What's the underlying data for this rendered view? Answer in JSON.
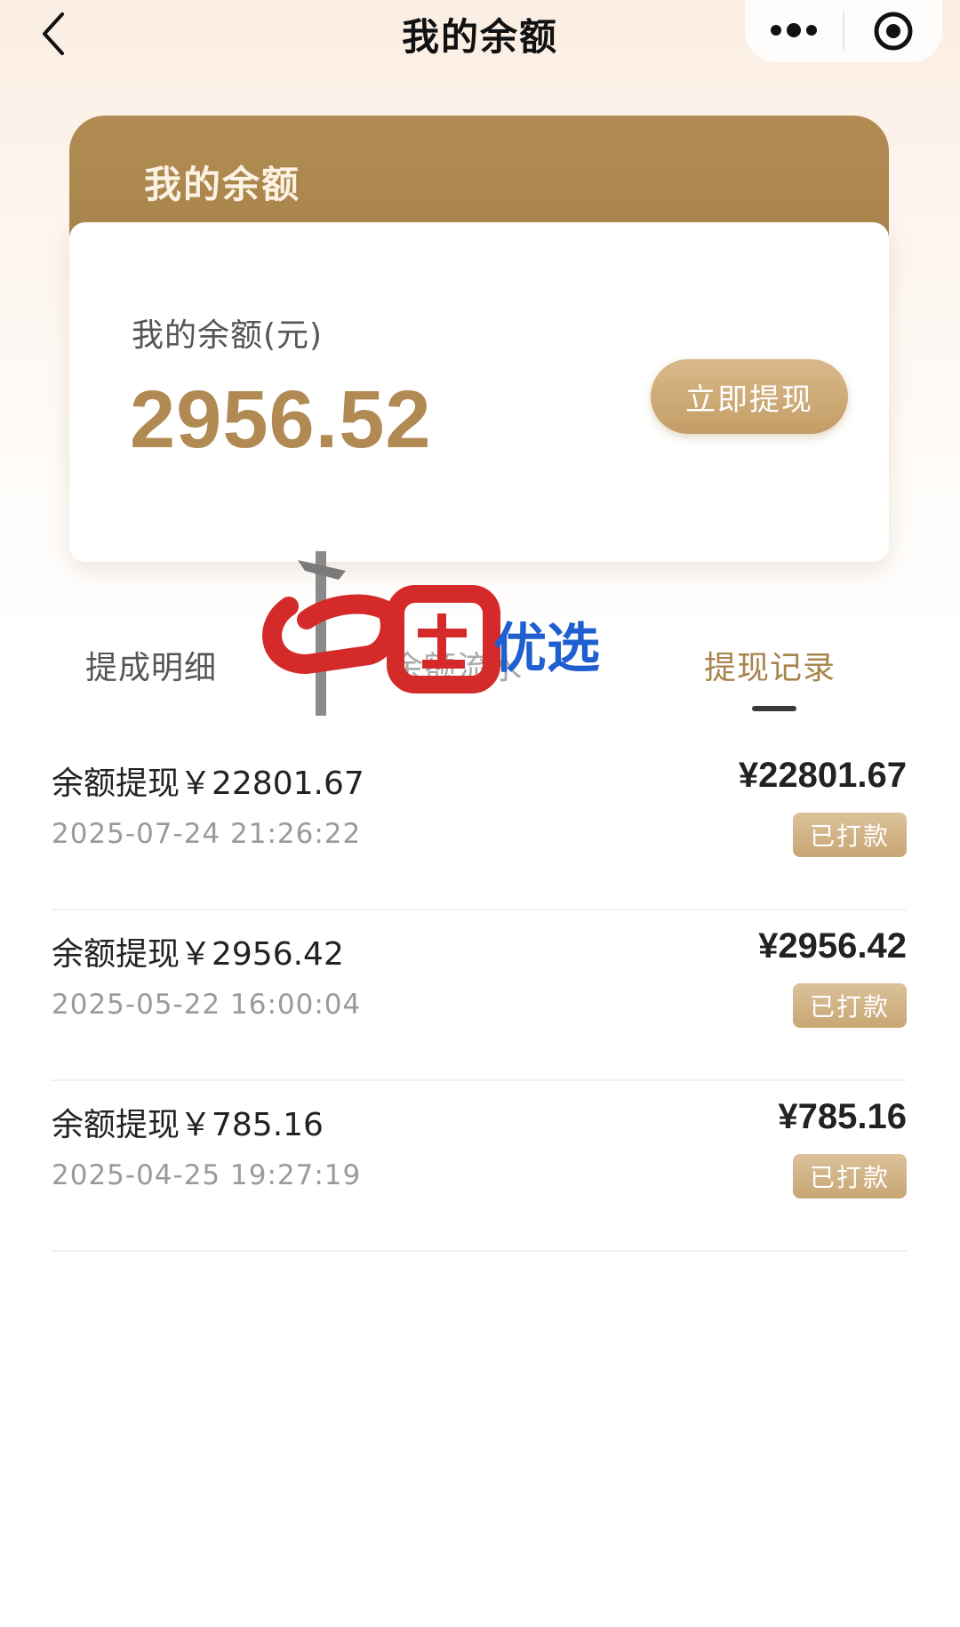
{
  "nav": {
    "title": "我的余额",
    "back_icon": "chevron-left-icon",
    "more_icon": "more-dots-icon",
    "target_icon": "target-circle-icon"
  },
  "balance": {
    "header_title": "我的余额",
    "label": "我的余额(元)",
    "amount": "2956.52",
    "withdraw_button": "立即提现"
  },
  "tabs": [
    {
      "label": "提成明细"
    },
    {
      "label": "余额流水"
    },
    {
      "label": "提现记录",
      "active": true
    }
  ],
  "watermark": {
    "text_red": "中国",
    "text_blue": "优选"
  },
  "records": [
    {
      "title": "余额提现￥22801.67",
      "time": "2025-07-24 21:26:22",
      "amount": "¥22801.67",
      "status": "已打款"
    },
    {
      "title": "余额提现￥2956.42",
      "time": "2025-05-22 16:00:04",
      "amount": "¥2956.42",
      "status": "已打款"
    },
    {
      "title": "余额提现￥785.16",
      "time": "2025-04-25 19:27:19",
      "amount": "¥785.16",
      "status": "已打款"
    }
  ],
  "colors": {
    "gold": "#a8844c",
    "gold_light": "#d9b98a",
    "amount_gold": "#b08a52"
  }
}
